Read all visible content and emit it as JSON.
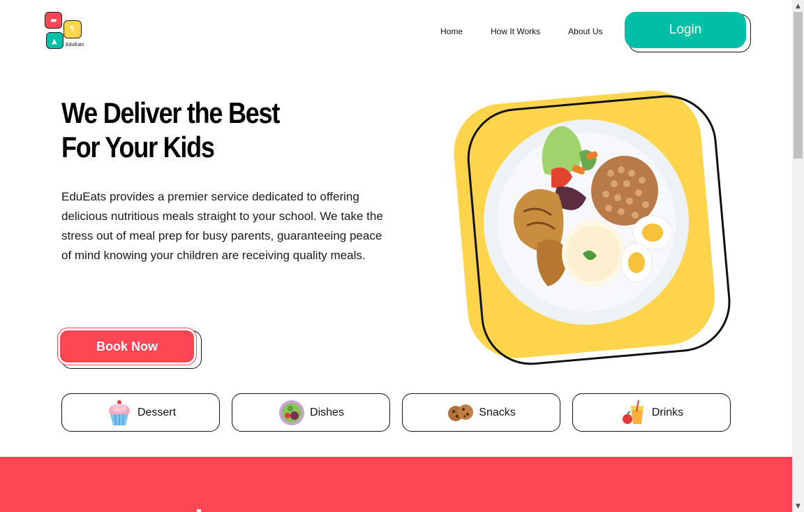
{
  "brand": {
    "name": "EduEats"
  },
  "nav": {
    "items": [
      "Home",
      "How It Works",
      "About Us"
    ],
    "login_label": "Login"
  },
  "hero": {
    "title_line1": "We Deliver the Best",
    "title_line2": "For Your Kids",
    "description": "EduEats provides a premier service dedicated to offering delicious nutritious meals straight to your school. We take the stress out of meal prep for busy parents, guaranteeing peace of mind knowing your children are receiving quality meals.",
    "cta_label": "Book Now"
  },
  "categories": [
    {
      "label": "Dessert",
      "icon": "cupcake-icon"
    },
    {
      "label": "Dishes",
      "icon": "salad-bowl-icon"
    },
    {
      "label": "Snacks",
      "icon": "cookies-icon"
    },
    {
      "label": "Drinks",
      "icon": "juice-icon"
    }
  ],
  "colors": {
    "accent_red": "#ff4654",
    "accent_teal": "#00bfa6",
    "accent_yellow": "#ffd44d"
  }
}
